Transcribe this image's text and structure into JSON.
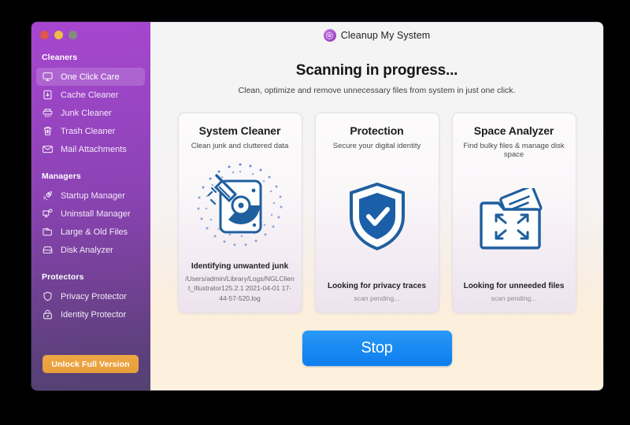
{
  "window": {
    "traffic_lights": [
      "close",
      "minimize",
      "zoom"
    ]
  },
  "brand": {
    "name": "Cleanup My System",
    "mark_icon": "app-logo-icon"
  },
  "sidebar": {
    "sections": [
      {
        "title": "Cleaners",
        "items": [
          {
            "label": "One Click Care",
            "icon": "monitor-icon",
            "active": true
          },
          {
            "label": "Cache Cleaner",
            "icon": "cache-icon",
            "active": false
          },
          {
            "label": "Junk Cleaner",
            "icon": "shredder-icon",
            "active": false
          },
          {
            "label": "Trash Cleaner",
            "icon": "trash-icon",
            "active": false
          },
          {
            "label": "Mail Attachments",
            "icon": "mail-icon",
            "active": false
          }
        ]
      },
      {
        "title": "Managers",
        "items": [
          {
            "label": "Startup Manager",
            "icon": "rocket-icon",
            "active": false
          },
          {
            "label": "Uninstall Manager",
            "icon": "monitor-gear-icon",
            "active": false
          },
          {
            "label": "Large & Old Files",
            "icon": "folder-files-icon",
            "active": false
          },
          {
            "label": "Disk Analyzer",
            "icon": "disk-icon",
            "active": false
          }
        ]
      },
      {
        "title": "Protectors",
        "items": [
          {
            "label": "Privacy Protector",
            "icon": "shield-icon",
            "active": false
          },
          {
            "label": "Identity Protector",
            "icon": "lock-icon",
            "active": false
          }
        ]
      }
    ],
    "unlock_button": "Unlock Full Version"
  },
  "main": {
    "headline": "Scanning in progress...",
    "subheadline": "Clean, optimize and remove unnecessary files from system in just one click.",
    "cards": [
      {
        "title": "System Cleaner",
        "subtitle": "Clean junk and cluttered data",
        "icon": "disk-broom-scan-icon",
        "status": "Identifying unwanted junk",
        "detail": "/Users/admin/Library/Logs/NGLClient_Illustrator125.2.1 2021-04-01 17-44-57-520.log",
        "pending": false
      },
      {
        "title": "Protection",
        "subtitle": "Secure your digital identity",
        "icon": "shield-check-icon",
        "status": "Looking for privacy traces",
        "detail": "scan pending...",
        "pending": true
      },
      {
        "title": "Space Analyzer",
        "subtitle": "Find bulky files & manage disk space",
        "icon": "folder-expand-icon",
        "status": "Looking for unneeded files",
        "detail": "scan pending...",
        "pending": true
      }
    ],
    "stop_button": "Stop"
  },
  "colors": {
    "sidebar_top": "#a746cf",
    "sidebar_bottom": "#534272",
    "accent_blue": "#0d7df0",
    "unlock_orange": "#e89f3a",
    "icon_blue": "#1f5f9e"
  }
}
